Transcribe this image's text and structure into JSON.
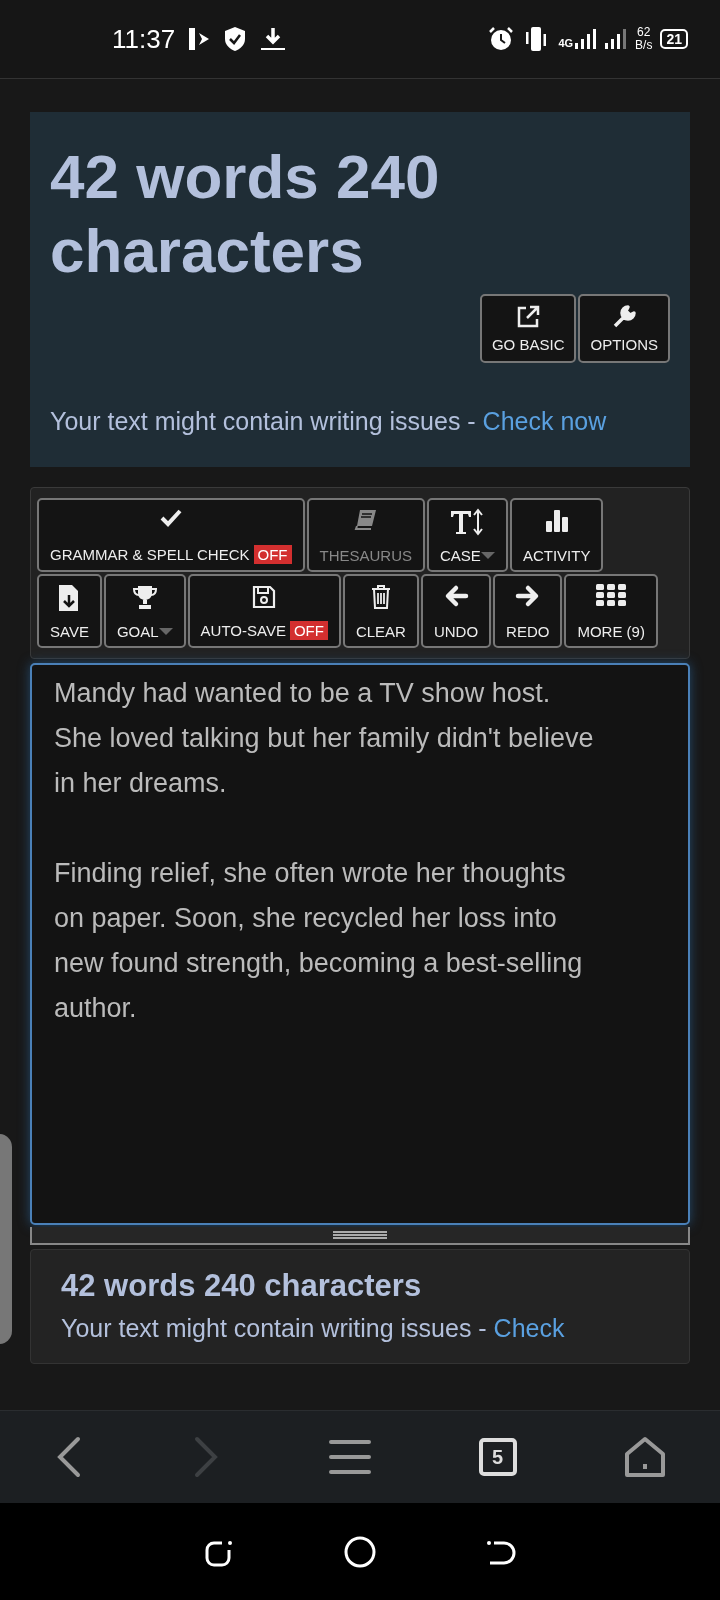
{
  "status_bar": {
    "time": "11:37",
    "network": "4G",
    "speed": "62",
    "speed_unit": "B/s",
    "battery": "21"
  },
  "header": {
    "title": "42 words 240 characters",
    "buttons": [
      {
        "label": "GO BASIC",
        "kind": "external"
      },
      {
        "label": "OPTIONS",
        "kind": "wrench"
      }
    ],
    "notice": {
      "text": "Your text might contain writing issues - ",
      "link": "Check now"
    }
  },
  "toolbar": {
    "buttons": [
      {
        "label": "GRAMMAR & SPELL CHECK",
        "kind": "check",
        "badge": "OFF",
        "dropdown": false,
        "disabled": false
      },
      {
        "label": "THESAURUS",
        "kind": "book",
        "dropdown": false,
        "disabled": true
      },
      {
        "label": "CASE",
        "kind": "case",
        "dropdown": true,
        "disabled": false
      },
      {
        "label": "ACTIVITY",
        "kind": "chart",
        "dropdown": false,
        "disabled": false
      },
      {
        "label": "SAVE",
        "kind": "save",
        "dropdown": false,
        "disabled": false
      },
      {
        "label": "GOAL",
        "kind": "trophy",
        "dropdown": true,
        "disabled": false
      },
      {
        "label": "AUTO-SAVE",
        "kind": "disk",
        "badge": "OFF",
        "dropdown": false,
        "disabled": false
      },
      {
        "label": "CLEAR",
        "kind": "trash",
        "dropdown": false,
        "disabled": false
      },
      {
        "label": "UNDO",
        "kind": "left",
        "dropdown": false,
        "disabled": false
      },
      {
        "label": "REDO",
        "kind": "right",
        "dropdown": false,
        "disabled": false
      },
      {
        "label": "MORE (9)",
        "kind": "grid",
        "dropdown": false,
        "disabled": false
      }
    ]
  },
  "editor": {
    "paragraphs": [
      "Mandy had wanted to be a TV show host. She loved talking but her family didn't believe in her dreams.",
      "Finding relief, she often wrote her thoughts on paper. Soon, she recycled her loss into new found strength, becoming a best-selling author."
    ]
  },
  "summary": {
    "title": "42 words 240 characters",
    "notice": {
      "text": "Your text might contain writing issues - ",
      "link": "Check"
    }
  },
  "browser_nav": [
    {
      "kind": "back",
      "disabled": false
    },
    {
      "kind": "forward",
      "disabled": true
    },
    {
      "kind": "menu",
      "disabled": false
    },
    {
      "kind": "tabs",
      "label": "5",
      "disabled": false
    },
    {
      "kind": "home",
      "disabled": false
    }
  ]
}
